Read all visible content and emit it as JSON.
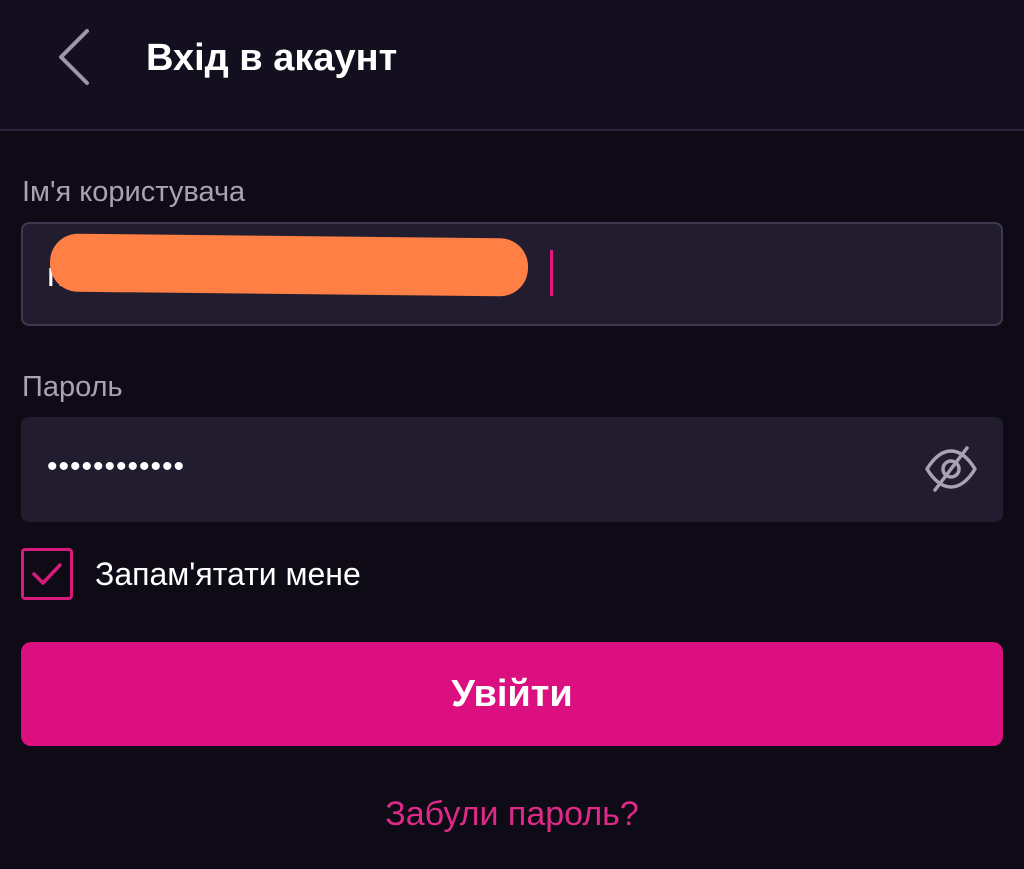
{
  "header": {
    "title": "Вхід в акаунт",
    "back_icon": "chevron-left-icon"
  },
  "form": {
    "username": {
      "label": "Ім'я користувача",
      "value": "m                          m"
    },
    "password": {
      "label": "Пароль",
      "masked_value": "••••••••••••",
      "toggle_icon": "eye-off-icon"
    },
    "remember": {
      "label": "Запам'ятати мене",
      "checked": true
    },
    "submit_label": "Увійти",
    "forgot_label": "Забули пароль?"
  },
  "colors": {
    "background": "#0e0a16",
    "header_background": "#140f1f",
    "input_background": "#211c2e",
    "accent": "#db0f80",
    "link": "#dc2a86",
    "label": "#a8a2b3",
    "redaction": "#ff7f44"
  }
}
